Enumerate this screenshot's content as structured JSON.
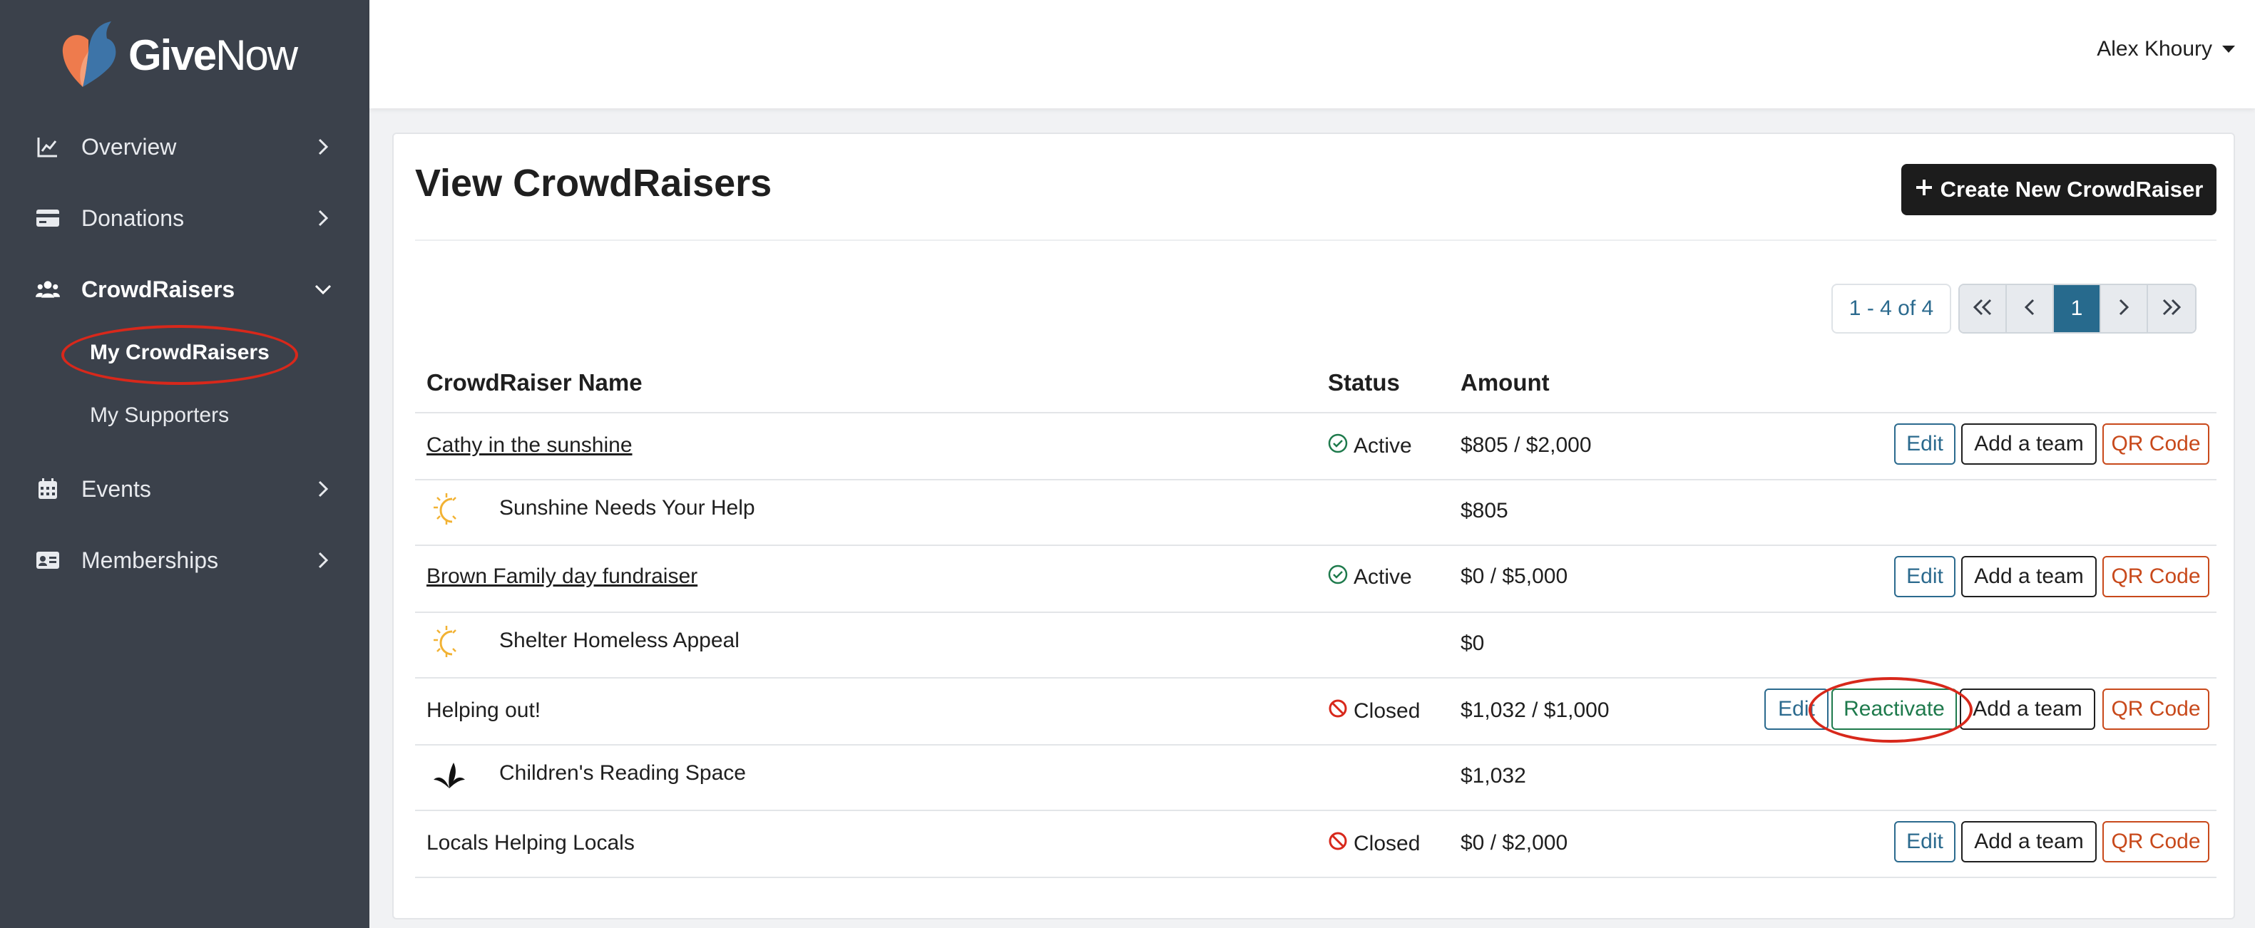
{
  "brand": {
    "logo_text_give": "Give",
    "logo_text_now": "Now",
    "colors": {
      "sidebar": "#3b414b",
      "accent_blue": "#276a8d",
      "qr_orange": "#c8491b",
      "success_green": "#1e7a4c",
      "closed_red": "#d8281b",
      "logo_orange": "#ee7b4d",
      "logo_blue": "#3d74a8"
    }
  },
  "sidebar": {
    "items": [
      {
        "label": "Overview",
        "icon": "line-chart-icon",
        "chevron": "chevron-right-icon"
      },
      {
        "label": "Donations",
        "icon": "credit-card-icon",
        "chevron": "chevron-right-icon"
      },
      {
        "label": "CrowdRaisers",
        "icon": "users-icon",
        "chevron": "chevron-down-icon"
      },
      {
        "label": "Events",
        "icon": "calendar-icon",
        "chevron": "chevron-right-icon"
      },
      {
        "label": "Memberships",
        "icon": "id-card-icon",
        "chevron": "chevron-right-icon"
      }
    ],
    "subitems": [
      {
        "label": "My CrowdRaisers"
      },
      {
        "label": "My Supporters"
      }
    ]
  },
  "header": {
    "user_name": "Alex Khoury"
  },
  "main": {
    "title": "View CrowdRaisers",
    "create_label": "Create New CrowdRaiser",
    "pagination": {
      "range": "1 - 4 of 4",
      "current_page": "1"
    },
    "columns": [
      "CrowdRaiser Name",
      "Status",
      "Amount"
    ],
    "buttons": {
      "edit": "Edit",
      "add_team": "Add a team",
      "qr_code": "QR Code",
      "reactivate": "Reactivate"
    },
    "rows": [
      {
        "name": "Cathy in the sunshine",
        "status": "Active",
        "amount": "$805 / $2,000",
        "sub_name": "Sunshine Needs Your Help",
        "sub_amount": "$805",
        "sub_icon": "sun-icon"
      },
      {
        "name": "Brown Family day fundraiser",
        "status": "Active",
        "amount": "$0 / $5,000",
        "sub_name": "Shelter Homeless Appeal",
        "sub_amount": "$0",
        "sub_icon": "sun-icon"
      },
      {
        "name": "Helping out!",
        "status": "Closed",
        "amount": "$1,032 / $1,000",
        "sub_name": "Children's Reading Space",
        "sub_amount": "$1,032",
        "sub_icon": "leaf-logo-icon"
      },
      {
        "name": "Locals Helping Locals",
        "status": "Closed",
        "amount": "$0 / $2,000"
      }
    ]
  }
}
